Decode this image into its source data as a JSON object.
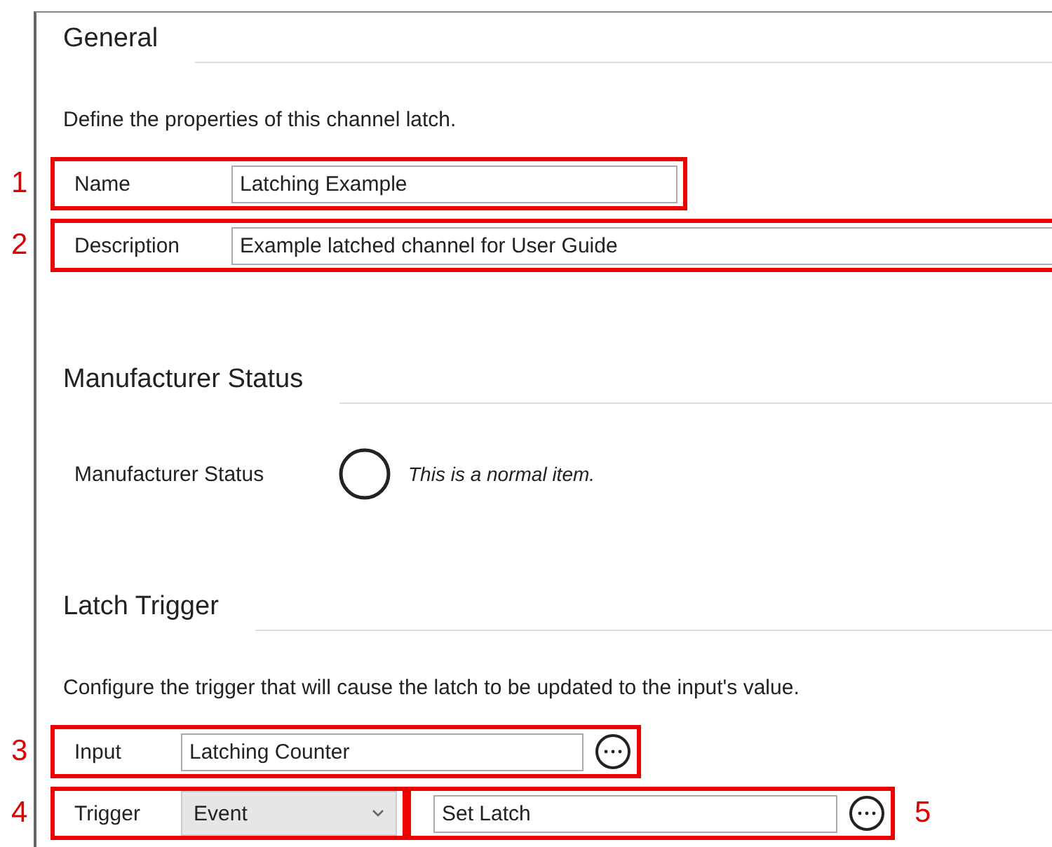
{
  "sections": [
    {
      "title": "General",
      "description": "Define the properties of this channel latch.",
      "rows": [
        {
          "items": [
            {
              "callout": "1",
              "label": "Name",
              "kind": "text",
              "value": "Latching Example"
            }
          ]
        },
        {
          "items": [
            {
              "callout": "2",
              "label": "Description",
              "kind": "long-text",
              "value": "Example latched channel for User Guide"
            }
          ]
        }
      ]
    },
    {
      "title": "Manufacturer Status",
      "rows": [
        {
          "items": [
            {
              "label": "Manufacturer Status",
              "kind": "status",
              "value": "This is a normal item."
            }
          ]
        }
      ]
    },
    {
      "title": "Latch Trigger",
      "description": "Configure the trigger that will cause the latch to be updated to the input's value.",
      "rows": [
        {
          "items": [
            {
              "callout": "3",
              "label": "Input",
              "kind": "browse",
              "value": "Latching Counter"
            }
          ]
        },
        {
          "items": [
            {
              "callout": "4",
              "label": "Trigger",
              "kind": "select",
              "value": "Event"
            },
            {
              "callout": "5",
              "kind": "browse",
              "value": "Set Latch"
            }
          ]
        }
      ]
    }
  ]
}
